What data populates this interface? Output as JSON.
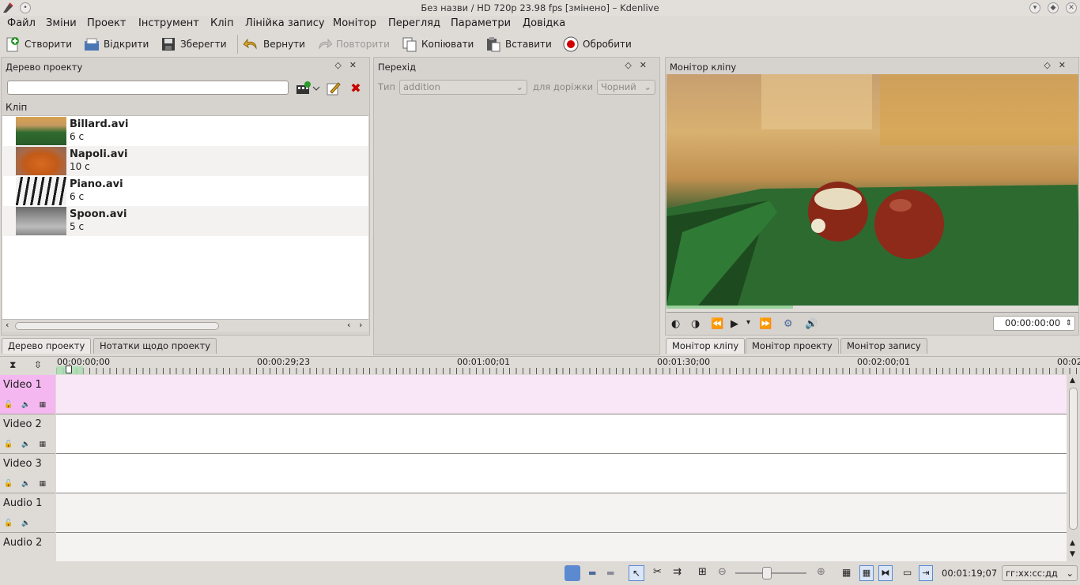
{
  "window": {
    "title": "Без назви / HD 720p 23.98 fps [змінено] – Kdenlive"
  },
  "menu": [
    "Файл",
    "Зміни",
    "Проект",
    "Інструмент",
    "Кліп",
    "Лінійка запису",
    "Монітор",
    "Перегляд",
    "Параметри",
    "Довідка"
  ],
  "toolbar": {
    "create": "Створити",
    "open": "Відкрити",
    "save": "Зберегти",
    "undo": "Вернути",
    "redo": "Повторити",
    "copy": "Копіювати",
    "paste": "Вставити",
    "render": "Обробити"
  },
  "project_tree": {
    "title": "Дерево проекту",
    "search_value": "",
    "column_header": "Кліп",
    "clips": [
      {
        "name": "Billard.avi",
        "duration": "6 с"
      },
      {
        "name": "Napoli.avi",
        "duration": "10 с"
      },
      {
        "name": "Piano.avi",
        "duration": "6 с"
      },
      {
        "name": "Spoon.avi",
        "duration": "5 с"
      }
    ],
    "tabs": [
      "Дерево проекту",
      "Нотатки щодо проекту"
    ]
  },
  "transition": {
    "title": "Перехід",
    "type_label": "Тип",
    "type_value": "addition",
    "track_label": "для доріжки",
    "track_value": "Чорний"
  },
  "clip_monitor": {
    "title": "Монітор кліпу",
    "timecode": "00:00:00:00",
    "tabs": [
      "Монітор кліпу",
      "Монітор проекту",
      "Монітор запису"
    ]
  },
  "timeline": {
    "ruler": [
      "00:00:00;00",
      "00:00:29;23",
      "00:01:00;01",
      "00:01:30;00",
      "00:02:00;01",
      "00:02"
    ],
    "tracks": [
      {
        "name": "Video 1",
        "kind": "video"
      },
      {
        "name": "Video 2",
        "kind": "video"
      },
      {
        "name": "Video 3",
        "kind": "video"
      },
      {
        "name": "Audio 1",
        "kind": "audio"
      },
      {
        "name": "Audio 2",
        "kind": "audio"
      }
    ]
  },
  "statusbar": {
    "timecode": "00:01:19;07",
    "format": "гг:хх:сс:дд"
  },
  "colors": {
    "selected_track": "#f9e6f6",
    "selected_head": "#f4b7f0",
    "accent": "#c80000"
  }
}
